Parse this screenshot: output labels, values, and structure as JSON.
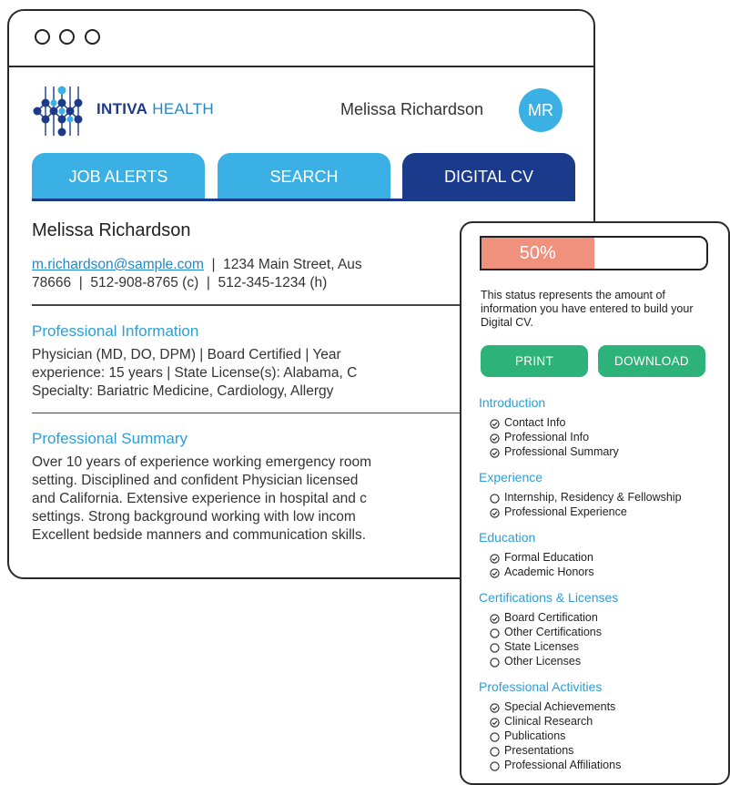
{
  "window": {
    "brand": {
      "strong": "INTIVA",
      "light": " HEALTH"
    },
    "user_name": "Melissa Richardson",
    "avatar_initials": "MR",
    "tabs": [
      {
        "label": "JOB ALERTS",
        "active": false
      },
      {
        "label": "SEARCH",
        "active": false
      },
      {
        "label": "DIGITAL CV",
        "active": true
      }
    ],
    "cv": {
      "name": "Melissa Richardson",
      "email": "m.richardson@sample.com",
      "contact_line1_rest": "  |  1234 Main Street, Aus",
      "contact_line2": "78666  |  512-908-8765 (c)  |  512-345-1234 (h)",
      "sections": [
        {
          "title": "Professional Information",
          "lines": [
            "Physician (MD, DO, DPM)  |  Board Certified  |  Year",
            "experience: 15 years  |  State License(s): Alabama, C",
            "Specialty: Bariatric Medicine, Cardiology, Allergy"
          ]
        },
        {
          "title": "Professional Summary",
          "lines": [
            "Over 10 years of experience working emergency room",
            "setting. Disciplined and confident Physician licensed",
            "and California. Extensive experience in hospital and c",
            "settings. Strong background working with low incom",
            "Excellent bedside manners and communication skills."
          ]
        }
      ]
    }
  },
  "panel": {
    "progress_label": "50%",
    "progress_fraction": 0.5,
    "status_text": "This status represents the amount of information you have entered to build your Digital CV.",
    "print_label": "PRINT",
    "download_label": "DOWNLOAD",
    "groups": [
      {
        "title": "Introduction",
        "items": [
          {
            "label": "Contact Info",
            "done": true
          },
          {
            "label": "Professional Info",
            "done": true
          },
          {
            "label": "Professional Summary",
            "done": true
          }
        ]
      },
      {
        "title": "Experience",
        "items": [
          {
            "label": "Internship, Residency & Fellowship",
            "done": false
          },
          {
            "label": "Professional Experience",
            "done": true
          }
        ]
      },
      {
        "title": "Education",
        "items": [
          {
            "label": "Formal Education",
            "done": true
          },
          {
            "label": "Academic Honors",
            "done": true
          }
        ]
      },
      {
        "title": "Certifications & Licenses",
        "items": [
          {
            "label": "Board Certification",
            "done": true
          },
          {
            "label": "Other Certifications",
            "done": false
          },
          {
            "label": "State Licenses",
            "done": false
          },
          {
            "label": "Other Licenses",
            "done": false
          }
        ]
      },
      {
        "title": "Professional Activities",
        "items": [
          {
            "label": "Special Achievements",
            "done": true
          },
          {
            "label": "Clinical Research",
            "done": true
          },
          {
            "label": "Publications",
            "done": false
          },
          {
            "label": "Presentations",
            "done": false
          },
          {
            "label": "Professional Affiliations",
            "done": false
          }
        ]
      }
    ]
  },
  "colors": {
    "light_blue": "#3ab0e4",
    "navy": "#1a3a8c",
    "section_blue": "#2b9fd8",
    "progress_salmon": "#f0917e",
    "button_green": "#2db37a"
  },
  "icons": {
    "done": "check-circle-icon",
    "todo": "empty-circle-icon"
  }
}
